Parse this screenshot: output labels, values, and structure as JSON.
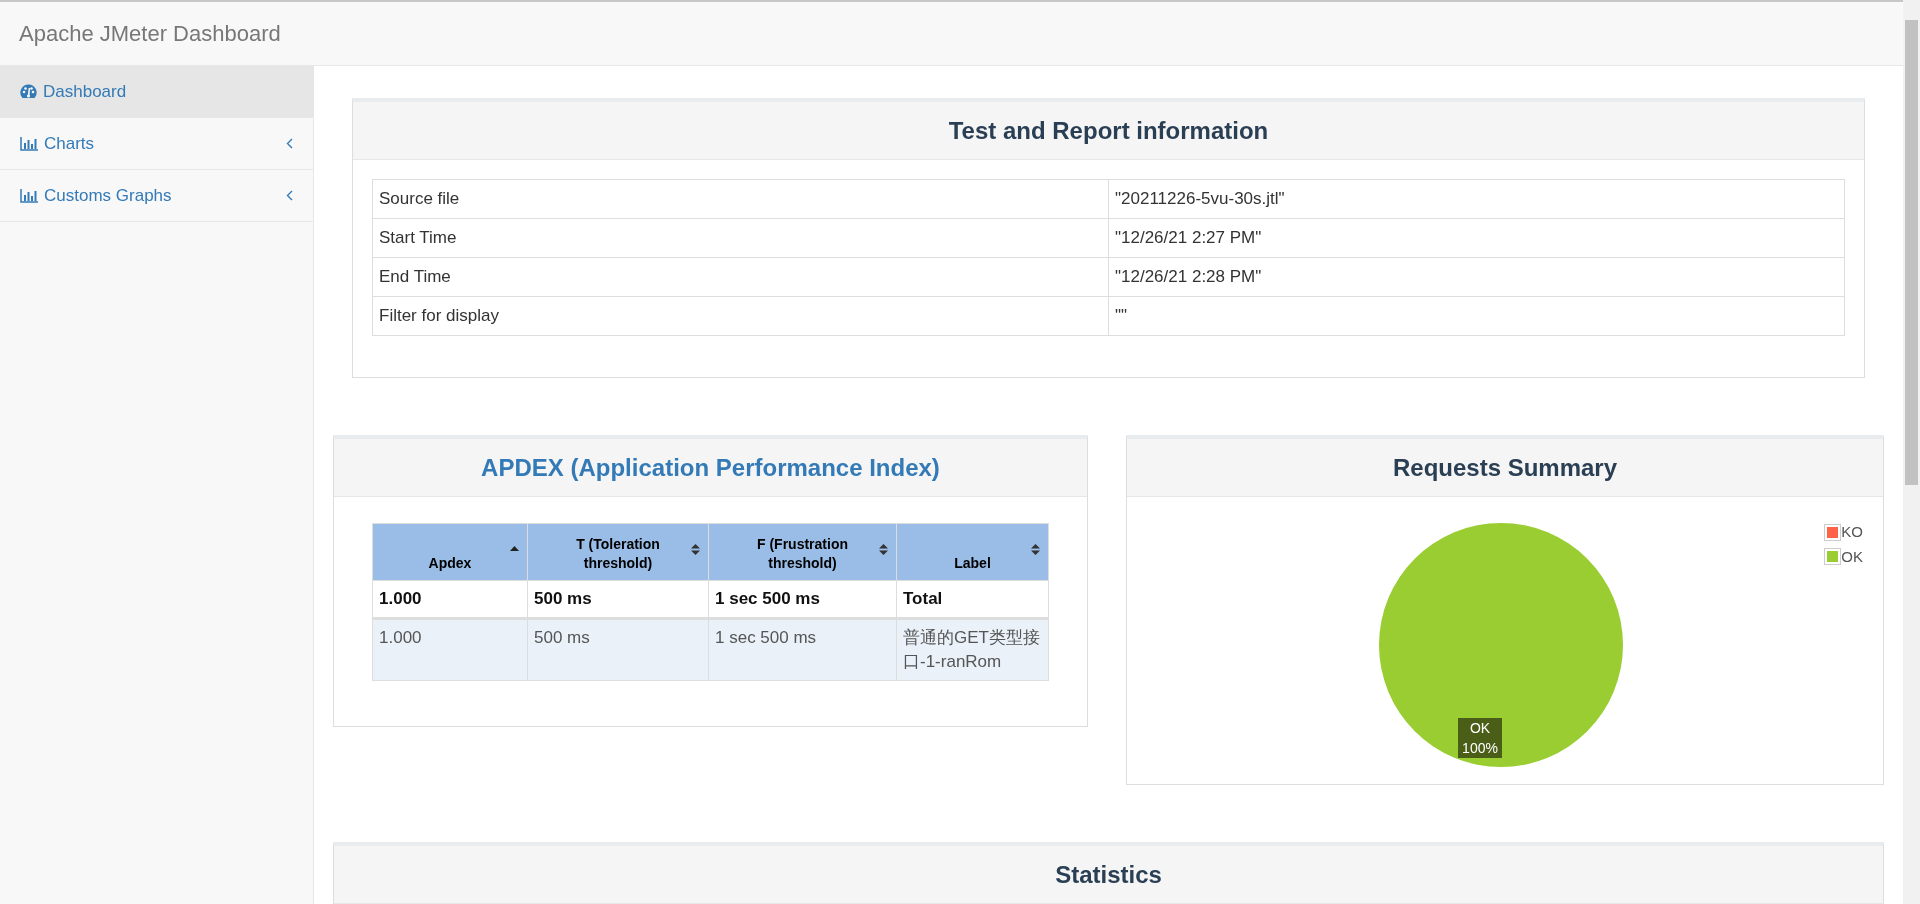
{
  "navbar": {
    "title": "Apache JMeter Dashboard"
  },
  "sidebar": {
    "items": [
      {
        "label": "Dashboard",
        "kind": "dashboard",
        "selected": true,
        "has_submenu": false
      },
      {
        "label": "Charts",
        "kind": "chart",
        "selected": false,
        "has_submenu": true
      },
      {
        "label": "Customs Graphs",
        "kind": "chart",
        "selected": false,
        "has_submenu": true
      }
    ]
  },
  "report_info": {
    "title": "Test and Report information",
    "rows": [
      {
        "name": "Source file",
        "value": "\"20211226-5vu-30s.jtl\""
      },
      {
        "name": "Start Time",
        "value": "\"12/26/21 2:27 PM\""
      },
      {
        "name": "End Time",
        "value": "\"12/26/21 2:28 PM\""
      },
      {
        "name": "Filter for display",
        "value": "\"\""
      }
    ]
  },
  "apdex": {
    "title": "APDEX (Application Performance Index)",
    "columns": [
      {
        "label": "Apdex",
        "sorted_ascending": true
      },
      {
        "label": "T (Toleration threshold)",
        "sorted_ascending": false
      },
      {
        "label": "F (Frustration threshold)",
        "sorted_ascending": false
      },
      {
        "label": "Label",
        "sorted_ascending": false
      }
    ],
    "rows": [
      {
        "kind": "total",
        "cells": [
          "1.000",
          "500 ms",
          "1 sec 500 ms",
          "Total"
        ]
      },
      {
        "kind": "item",
        "cells": [
          "1.000",
          "500 ms",
          "1 sec 500 ms",
          "普通的GET类型接口-1-ranRom"
        ]
      }
    ]
  },
  "requests_summary": {
    "title": "Requests Summary",
    "legend": [
      {
        "color": "#ff6347"
      },
      {
        "color": "#9acd32"
      }
    ],
    "chart_data": {
      "type": "pie",
      "categories": [
        "KO",
        "OK"
      ],
      "values": [
        0,
        100
      ]
    },
    "slice_labels": [
      {
        "category": "OK",
        "share": "100%"
      }
    ]
  },
  "statistics": {
    "title": "Statistics"
  }
}
